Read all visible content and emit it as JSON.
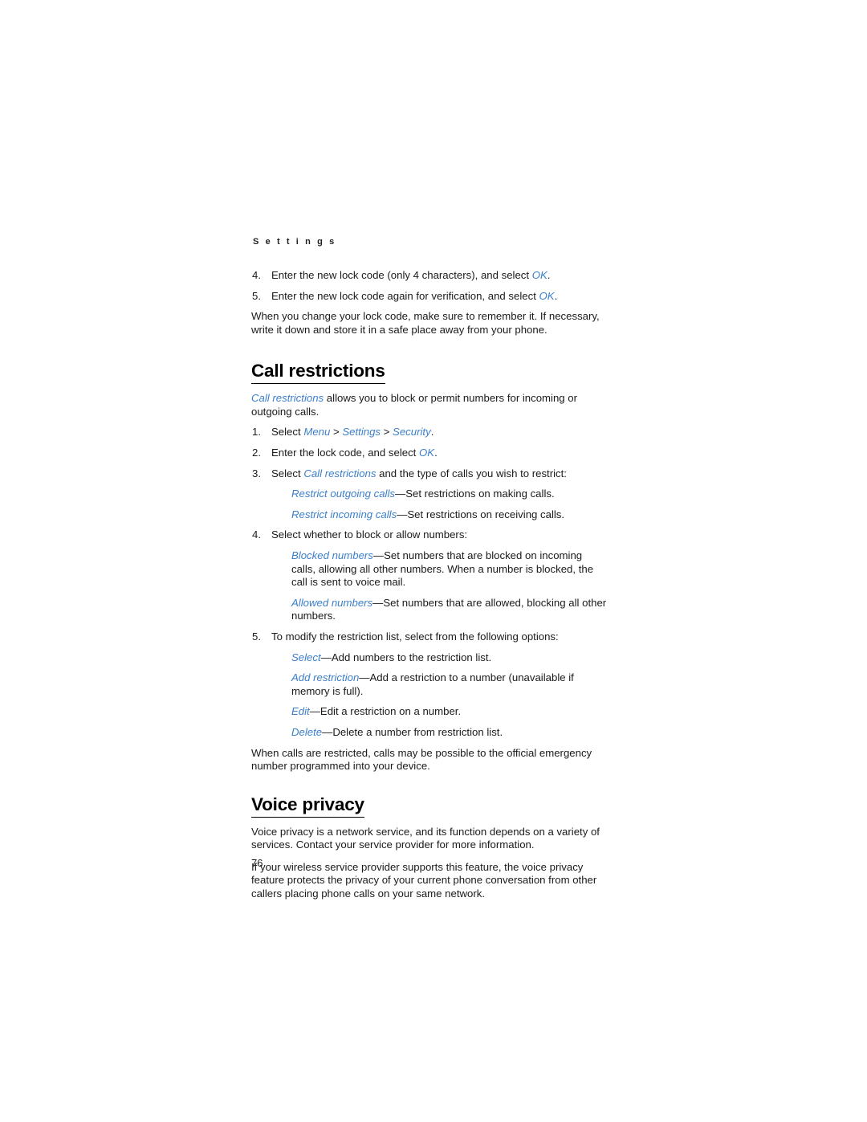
{
  "page": {
    "running_head": "S e t t i n g s",
    "folio": "76",
    "ui_term_color": "#3b7fcc",
    "text_color": "#1a1a1a",
    "background_color": "#ffffff"
  },
  "top_steps": [
    {
      "number": "4.",
      "text_before": "Enter the new lock code (only 4 characters), and select ",
      "ui_term": "OK",
      "text_after": "."
    },
    {
      "number": "5.",
      "text_before": "Enter the new lock code again for verification, and select ",
      "ui_term": "OK",
      "text_after": "."
    }
  ],
  "top_paragraph": "When you change your lock code, make sure to remember it. If necessary, write it down and store it in a safe place away from your phone.",
  "call_restrictions": {
    "heading": "Call restrictions",
    "intro_ui": "Call restrictions",
    "intro_rest": " allows you to block or permit numbers for incoming or outgoing calls.",
    "step1": {
      "number": "1.",
      "lead": "Select ",
      "menu": "Menu",
      "sep1": " > ",
      "settings": "Settings",
      "sep2": " > ",
      "security": "Security",
      "period": "."
    },
    "step2": {
      "number": "2.",
      "lead": "Enter the lock code, and select ",
      "ui_term": "OK",
      "period": "."
    },
    "step3": {
      "number": "3.",
      "lead": "Select ",
      "ui_term": "Call restrictions",
      "rest": " and the type of calls you wish to restrict:",
      "options": [
        {
          "term": "Restrict outgoing calls",
          "dash": "—",
          "desc": "Set restrictions on making calls."
        },
        {
          "term": "Restrict incoming calls",
          "dash": "—",
          "desc": "Set restrictions on receiving calls."
        }
      ]
    },
    "step4": {
      "number": "4.",
      "lead": "Select whether to block or allow numbers:",
      "options": [
        {
          "term": "Blocked numbers",
          "dash": "—",
          "desc": "Set numbers that are blocked on incoming calls, allowing all other numbers. When a number is blocked, the call is sent to voice mail."
        },
        {
          "term": "Allowed numbers",
          "dash": "—",
          "desc": "Set numbers that are allowed, blocking all other numbers."
        }
      ]
    },
    "step5": {
      "number": "5.",
      "lead": "To modify the restriction list, select from the following options:",
      "options": [
        {
          "term": "Select",
          "dash": "—",
          "desc": "Add numbers to the restriction list."
        },
        {
          "term": "Add restriction",
          "dash": "—",
          "desc": "Add a restriction to a number (unavailable if memory is full)."
        },
        {
          "term": "Edit",
          "dash": "—",
          "desc": "Edit a restriction on a number."
        },
        {
          "term": "Delete",
          "dash": "—",
          "desc": "Delete a number from restriction list."
        }
      ]
    },
    "closing_paragraph": "When calls are restricted, calls may be possible to the official emergency number programmed into your device."
  },
  "voice_privacy": {
    "heading": "Voice privacy",
    "paragraph1": "Voice privacy is a network service, and its function depends on a variety of services. Contact your service provider for more information.",
    "paragraph2": "If your wireless service provider supports this feature, the voice privacy feature protects the privacy of your current phone conversation from other callers placing phone calls on your same network."
  }
}
